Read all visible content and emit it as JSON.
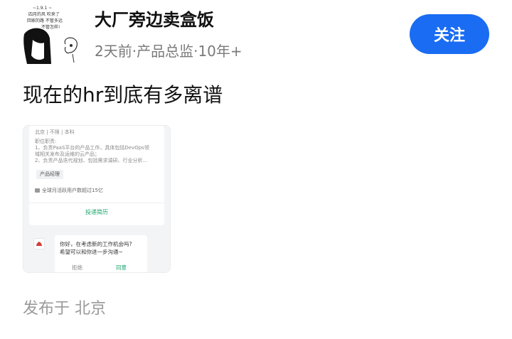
{
  "author": {
    "name": "大厂旁边卖盒饭",
    "meta": "2天前·产品总监·10年+",
    "avatar_handwriting": "四月的风 ... 回家的路 ... 不管"
  },
  "follow_button": {
    "label": "关注",
    "color": "#1a6cf3"
  },
  "post": {
    "title": "现在的hr到底有多离谱",
    "location": "发布于 北京"
  },
  "screenshot": {
    "job": {
      "tags": "北京 | 不限 | 本科",
      "desc_heading": "职位职责:",
      "desc_line1": "1、负责PaaS平台的产品工作，具体包括DevOps领",
      "desc_line2": "域相关发布及运维的云产品；",
      "desc_line3": "2、负责产品迭代规划、包括需求调研、行业分析...",
      "role": "产品经理",
      "users": "全球月活跃用户数超过15亿",
      "apply": "投递简历"
    },
    "chat": {
      "line1": "你好，在考虑新的工作机会吗?",
      "line2": "希望可以和你进一步沟通~",
      "reject": "拒绝",
      "agree": "同意"
    }
  }
}
